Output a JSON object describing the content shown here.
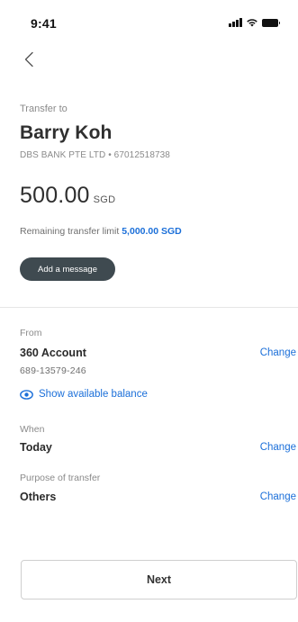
{
  "status_bar": {
    "time": "9:41",
    "icons": [
      "signal-icon",
      "wifi-icon",
      "battery-icon"
    ]
  },
  "nav": {
    "back_icon": "chevron-left-icon"
  },
  "recipient": {
    "label": "Transfer to",
    "name": "Barry Koh",
    "bank_info": "DBS BANK PTE LTD • 67012518738"
  },
  "amount": {
    "value": "500.00",
    "currency": "SGD"
  },
  "limit": {
    "label": "Remaining transfer limit",
    "value": "5,000.00 SGD"
  },
  "add_message_label": "Add a message",
  "from": {
    "label": "From",
    "account_name": "360 Account",
    "account_number": "689-13579-246",
    "change_label": "Change",
    "show_balance_label": "Show available balance",
    "show_balance_icon": "eye-icon"
  },
  "when": {
    "label": "When",
    "value": "Today",
    "change_label": "Change"
  },
  "purpose": {
    "label": "Purpose of transfer",
    "value": "Others",
    "change_label": "Change"
  },
  "next_label": "Next",
  "colors": {
    "accent": "#1b6fd9",
    "pill": "#3f4a50",
    "text": "#2b2b2b",
    "muted": "#8a8a8a"
  }
}
